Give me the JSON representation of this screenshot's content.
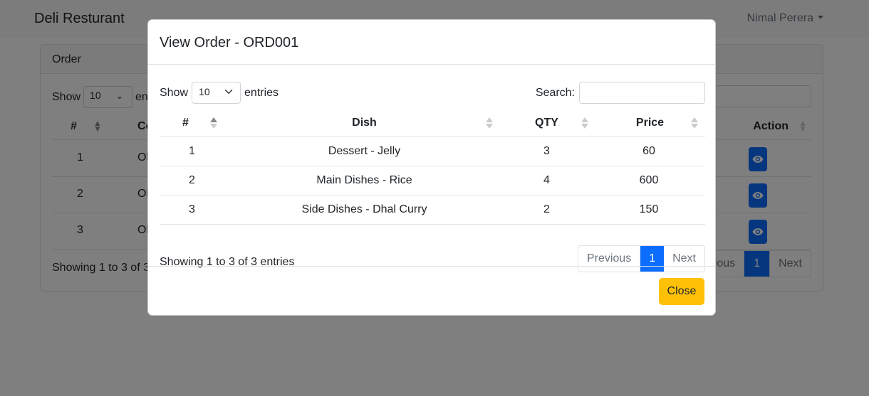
{
  "app": {
    "brand": "Deli Resturant",
    "user": "Nimal Perera"
  },
  "background": {
    "card_title": "Order",
    "show_label": "Show",
    "entries_label": "en",
    "length_value": "10",
    "headers": {
      "num": "#",
      "co": "Co",
      "action": "Action"
    },
    "rows": [
      {
        "num": "1",
        "co": "Ol"
      },
      {
        "num": "2",
        "co": "Ol"
      },
      {
        "num": "3",
        "co": "Ol"
      }
    ],
    "info": "Showing 1 to 3 of 3",
    "pager": {
      "previous": "ious",
      "page": "1",
      "next": "Next"
    }
  },
  "modal": {
    "title": "View Order - ORD001",
    "show_label": "Show",
    "length_value": "10",
    "entries_label": "entries",
    "search_label": "Search:",
    "search_value": "",
    "columns": [
      "#",
      "Dish",
      "QTY",
      "Price"
    ],
    "rows": [
      {
        "num": "1",
        "dish": "Dessert - Jelly",
        "qty": "3",
        "price": "60"
      },
      {
        "num": "2",
        "dish": "Main Dishes - Rice",
        "qty": "4",
        "price": "600"
      },
      {
        "num": "3",
        "dish": "Side Dishes - Dhal Curry",
        "qty": "2",
        "price": "150"
      }
    ],
    "info": "Showing 1 to 3 of 3 entries",
    "pager": {
      "previous": "Previous",
      "page": "1",
      "next": "Next"
    },
    "close_label": "Close"
  },
  "colors": {
    "primary": "#0d6efd",
    "warning": "#ffc107",
    "backdrop": "rgba(0,0,0,0.5)"
  }
}
